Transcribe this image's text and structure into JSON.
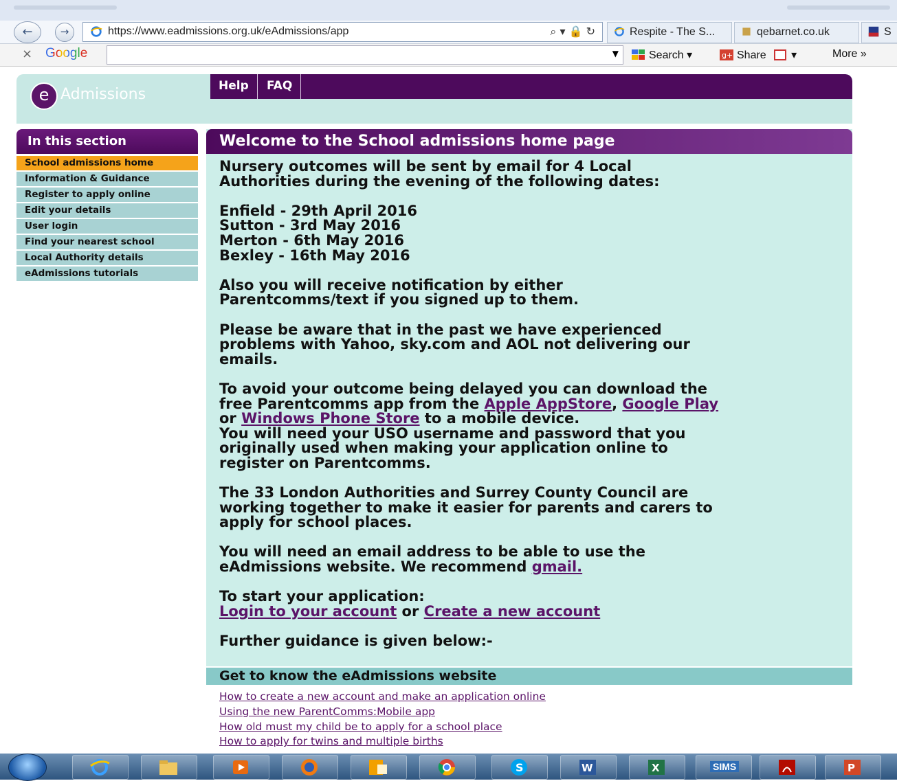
{
  "browser": {
    "url": "https://www.eadmissions.org.uk/eAdmissions/app",
    "address_tools": "⌕ ▾ 🔒 ↻",
    "tabs": [
      "Respite - The S...",
      "qebarnet.co.uk",
      "S"
    ],
    "google": {
      "logo": "Google",
      "close": "×",
      "search": "Search",
      "share": "Share",
      "more": "More »"
    }
  },
  "site": {
    "logo_letter": "e",
    "logo_word": "Admissions",
    "nav": [
      "Help",
      "FAQ"
    ]
  },
  "sidebar": {
    "heading": "In this section",
    "items": [
      "School admissions home",
      "Information & Guidance",
      "Register to apply online",
      "Edit your details",
      "User login",
      "Find your nearest school",
      "Local Authority details",
      "eAdmissions tutorials"
    ]
  },
  "main": {
    "heading": "Welcome to the School admissions home page",
    "p1_line1": "Nursery outcomes will be sent by email for 4 Local",
    "p1_line2": "Authorities during the evening of the following dates:",
    "dates": [
      "Enfield - 29th April 2016",
      "Sutton - 3rd May 2016",
      "Merton - 6th May 2016",
      "Bexley - 16th May 2016"
    ],
    "p2_line1": "Also you will receive notification by either",
    "p2_line2": "Parentcomms/text if you signed up to them.",
    "p3_line1": "Please be aware that in the past we have experienced",
    "p3_line2": "problems with Yahoo, sky.com and AOL not delivering our",
    "p3_line3": "emails.",
    "p4_line1": "To avoid your outcome being delayed you can download the",
    "p4_line2_pre": "free Parentcomms app from the ",
    "link_appstore": "Apple AppStore",
    "comma": ", ",
    "link_googleplay": "Google Play",
    "p4_line3_pre": "or ",
    "link_windows": "Windows Phone Store",
    "p4_line3_post": " to a mobile device.",
    "p4_line4": "You will need your USO username and password that you",
    "p4_line5": "originally used when making your application online to",
    "p4_line6": "register on Parentcomms.",
    "p5_line1": "The 33 London Authorities and Surrey County Council are",
    "p5_line2": "working together to make it easier for parents and carers to",
    "p5_line3": "apply for school places.",
    "p6_line1": "You will need an email address to be able to use the",
    "p6_line2_pre": "eAdmissions website. We recommend ",
    "link_gmail": "gmail.",
    "p7_line1": "To start your application:",
    "link_login": "Login to your account",
    "or": " or ",
    "link_create": "Create a new account",
    "p8": "Further guidance is given below:-"
  },
  "guide": {
    "heading": "Get to know the eAdmissions website",
    "links": [
      "How to create a new account and make an application online",
      "Using the new ParentComms:Mobile app",
      "How old must my child be to apply for a school place",
      "How to apply for twins and multiple births"
    ]
  },
  "taskbar": {
    "sims": "SIMS"
  }
}
